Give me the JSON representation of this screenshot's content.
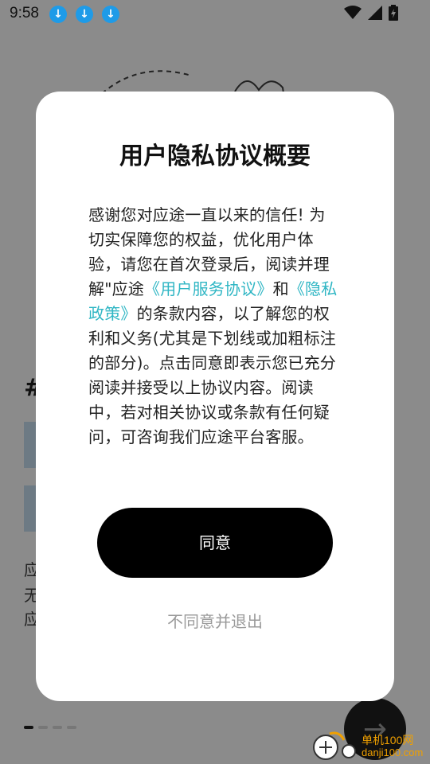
{
  "status_bar": {
    "time": "9:58",
    "notifications": [
      "download-icon",
      "download-icon",
      "download-icon"
    ]
  },
  "background": {
    "hash": "#",
    "line1": "应",
    "line2": "无",
    "line3": "应"
  },
  "dialog": {
    "title": "用户隐私协议概要",
    "body_part1": "感谢您对应途一直以来的信任! 为切实保障您的权益，优化用户体验，请您在首次登录后，阅读并理解\"应途",
    "link_service": "《用户服务协议》",
    "body_and": "和",
    "link_privacy": "《隐私政策》",
    "body_part2": "的条款内容，以了解您的权利和义务(尤其是下划线或加粗标注的部分)。点击同意即表示您已充分阅读并接受以上协议内容。阅读中，若对相关协议或条款有任何疑问，可咨询我们应途平台客服。",
    "agree_label": "同意",
    "decline_label": "不同意并退出"
  },
  "watermark": {
    "line1": "单机100网",
    "line2": "danji100.com"
  },
  "colors": {
    "overlay": "#8b8b8b",
    "link": "#2fb6c4",
    "download_badge": "#1e9be8"
  }
}
